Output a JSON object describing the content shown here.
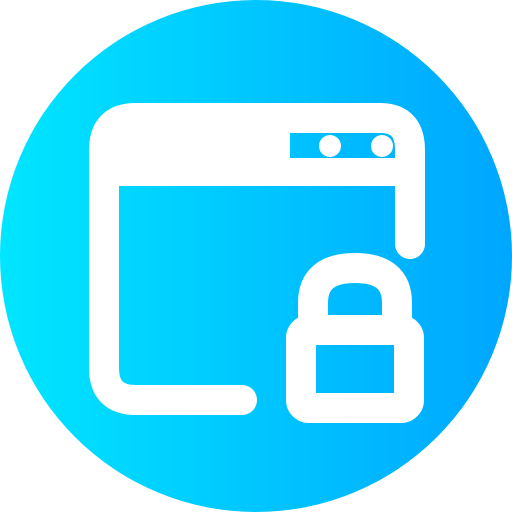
{
  "icon": {
    "name": "browser-window-lock-icon",
    "background_gradient_start": "#00E6FF",
    "background_gradient_end": "#00A6FF",
    "glyph_color": "#FFFFFF"
  }
}
